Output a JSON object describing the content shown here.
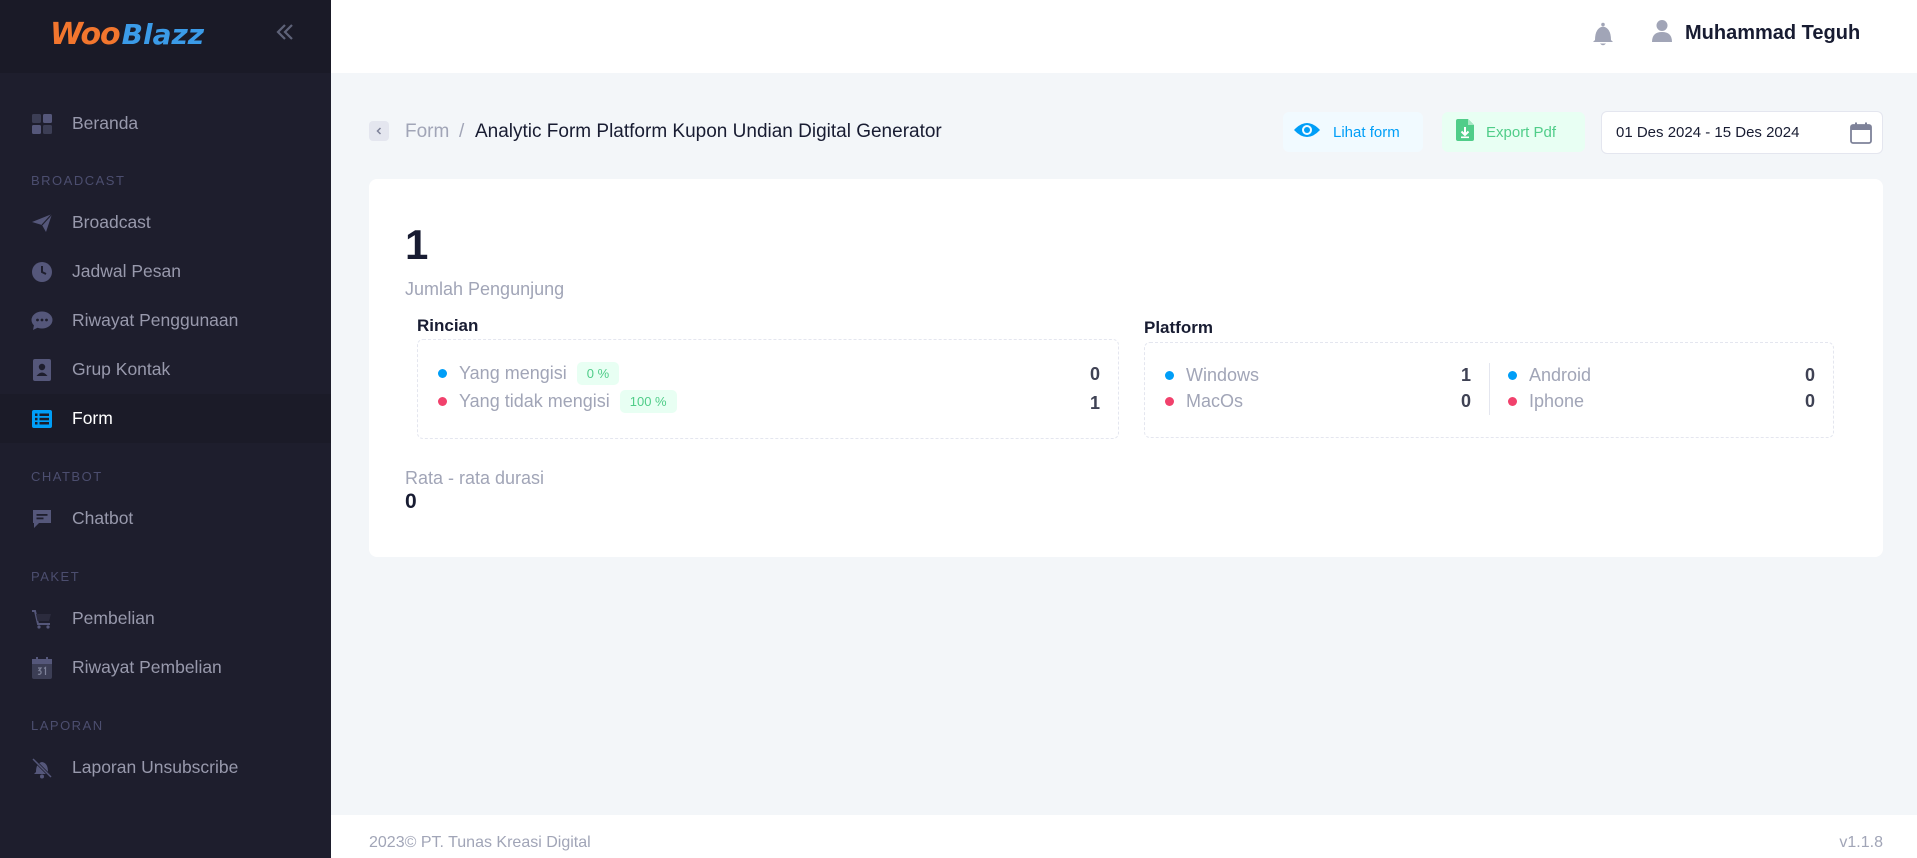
{
  "brand": {
    "part1": "Woo",
    "part2": "Blazz"
  },
  "sidebar": {
    "items": [
      {
        "label": "Beranda",
        "icon": "dashboard-icon"
      },
      {
        "section": "BROADCAST"
      },
      {
        "label": "Broadcast",
        "icon": "paper-plane-icon"
      },
      {
        "label": "Jadwal Pesan",
        "icon": "clock-icon"
      },
      {
        "label": "Riwayat Penggunaan",
        "icon": "chat-bubble-icon"
      },
      {
        "label": "Grup Kontak",
        "icon": "contact-book-icon"
      },
      {
        "label": "Form",
        "icon": "list-icon",
        "active": true
      },
      {
        "section": "CHATBOT"
      },
      {
        "label": "Chatbot",
        "icon": "message-icon"
      },
      {
        "section": "PAKET"
      },
      {
        "label": "Pembelian",
        "icon": "cart-icon"
      },
      {
        "label": "Riwayat Pembelian",
        "icon": "calendar-icon"
      },
      {
        "section": "LAPORAN"
      },
      {
        "label": "Laporan Unsubscribe",
        "icon": "bell-off-icon"
      }
    ]
  },
  "header": {
    "user_name": "Muhammad Teguh"
  },
  "breadcrumb": {
    "parent": "Form",
    "separator": "/",
    "current": "Analytic Form Platform Kupon Undian Digital Generator"
  },
  "toolbar": {
    "view_label": "Lihat form",
    "export_label": "Export Pdf",
    "date_range": "01 Des 2024 - 15 Des 2024"
  },
  "stats": {
    "visitors": "1",
    "visitors_label": "Jumlah Pengunjung",
    "rincian": {
      "title": "Rincian",
      "rows": [
        {
          "label": "Yang mengisi",
          "badge": "0 %",
          "value": "0"
        },
        {
          "label": "Yang tidak mengisi",
          "badge": "100 %",
          "value": "1"
        }
      ]
    },
    "platform": {
      "title": "Platform",
      "left": [
        {
          "label": "Windows",
          "value": "1"
        },
        {
          "label": "MacOs",
          "value": "0"
        }
      ],
      "right": [
        {
          "label": "Android",
          "value": "0"
        },
        {
          "label": "Iphone",
          "value": "0"
        }
      ]
    },
    "duration_label": "Rata - rata durasi",
    "duration_value": "0"
  },
  "footer": {
    "copyright": "2023© PT. Tunas Kreasi Digital",
    "version": "v1.1.8"
  },
  "colors": {
    "primary": "#009ef7",
    "success": "#50cd89",
    "danger": "#f1416c",
    "sidebar": "#1e1e2d",
    "logo_orange": "#f2762e",
    "logo_blue": "#3b9be8"
  }
}
